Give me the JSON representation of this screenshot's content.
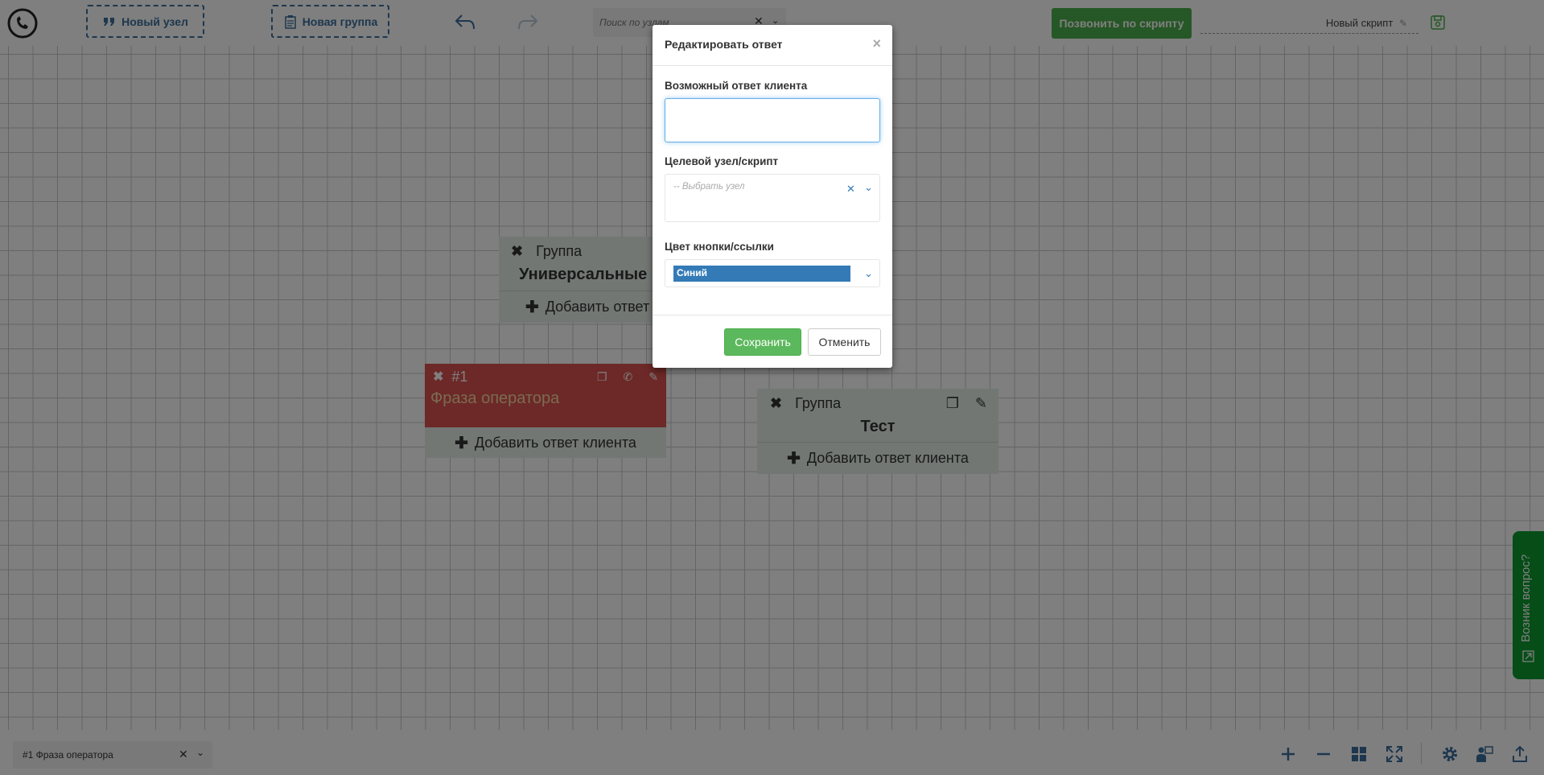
{
  "toolbar": {
    "new_node_label": "Новый узел",
    "new_group_label": "Новая группа",
    "search_placeholder": "Поиск по узлам",
    "call_by_script_label": "Позвонить по скрипту",
    "script_name": "Новый скрипт"
  },
  "nodes": {
    "group1": {
      "type_label": "Группа",
      "title": "Универсальные",
      "add_answer_label": "Добавить ответ"
    },
    "operator_node": {
      "id_label": "#1",
      "title": "Фраза оператора",
      "add_answer_label": "Добавить ответ клиента"
    },
    "group2": {
      "type_label": "Группа",
      "title": "Тест",
      "add_answer_label": "Добавить ответ клиента"
    }
  },
  "modal": {
    "title": "Редактировать ответ",
    "close_symbol": "×",
    "answer_label": "Возможный ответ клиента",
    "answer_value": "",
    "target_label": "Целевой узел/скрипт",
    "target_placeholder": "-- Выбрать узел",
    "color_label": "Цвет кнопки/ссылки",
    "color_value": "Синий",
    "save_label": "Сохранить",
    "cancel_label": "Отменить"
  },
  "bottombar": {
    "selected_node": "#1 Фраза оператора"
  },
  "help_tab": {
    "label": "Возник вопрос?"
  },
  "colors": {
    "brand_blue": "#3a6e9c",
    "call_green": "#4cae4c",
    "operator_red": "#d9534f",
    "group_bg": "#e4eee9",
    "help_green": "#0d9b2e",
    "selected_blue": "#337ab7"
  }
}
